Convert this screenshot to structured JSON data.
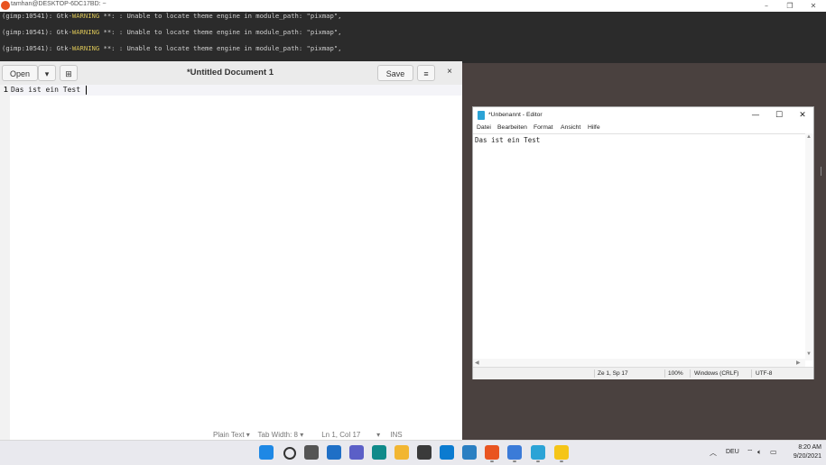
{
  "terminal": {
    "title": "tamhan@DESKTOP-6DC17BD: ~",
    "lines": [
      {
        "prefix": "(gimp:10541): Gtk-",
        "warn": "WARNING",
        "mid": " **: ",
        "mod": "",
        "rest": ": Unable to locate theme engine in module_path: \"pixmap\","
      },
      {
        "prefix": "(gimp:10541): Gtk-",
        "warn": "WARNING",
        "mid": " **: ",
        "mod": "",
        "rest": ": Unable to locate theme engine in module_path: \"pixmap\","
      },
      {
        "prefix": "(gimp:10541): Gtk-",
        "warn": "WARNING",
        "mid": " **: ",
        "mod": "",
        "rest": ": Unable to locate theme engine in module_path: \"pixmap\","
      }
    ],
    "controls": {
      "minimize": "–",
      "maximize": "❐",
      "close": "✕"
    }
  },
  "gedit": {
    "open_label": "Open",
    "dropdown": "▾",
    "new_tab": "⊞",
    "title": "*Untitled Document 1",
    "save_label": "Save",
    "menu": "≡",
    "close": "×",
    "line_number": "1",
    "text": "Das ist ein Test",
    "status": "Plain Text ▾    Tab Width: 8 ▾         Ln 1, Col 17        ▾     INS"
  },
  "notepad": {
    "title": "*Unbenannt - Editor",
    "controls": {
      "minimize": "—",
      "maximize": "☐",
      "close": "✕"
    },
    "menu": [
      "Datei",
      "Bearbeiten",
      "Format",
      "Ansicht",
      "Hilfe"
    ],
    "text": "Das ist ein Test",
    "status": {
      "position": "Ze 1, Sp 17",
      "zoom": "100%",
      "eol": "Windows (CRLF)",
      "encoding": "UTF-8"
    },
    "scroll": {
      "up": "▲",
      "down": "▼",
      "left": "◀",
      "right": "▶"
    }
  },
  "taskbar": {
    "tray": {
      "chevron": "︿",
      "lang": "DEU",
      "wifi": "⌔",
      "volume": "🔈︎",
      "battery": "▭",
      "time": "8:20 AM",
      "date": "9/20/2021"
    },
    "apps": [
      {
        "name": "start-icon",
        "color": "#1e88e5"
      },
      {
        "name": "search-icon",
        "color": "#e9e9ee"
      },
      {
        "name": "task-view-icon",
        "color": "#555555"
      },
      {
        "name": "widgets-icon",
        "color": "#1f6fc6"
      },
      {
        "name": "teams-icon",
        "color": "#5b5fc7"
      },
      {
        "name": "edge-icon",
        "color": "#0f8a8a"
      },
      {
        "name": "file-explorer-icon",
        "color": "#f2b632"
      },
      {
        "name": "store-icon",
        "color": "#3a3a3a"
      },
      {
        "name": "skype-icon",
        "color": "#0b7bd0"
      },
      {
        "name": "photos-icon",
        "color": "#2a7fc2"
      },
      {
        "name": "ubuntu-icon",
        "color": "#e95420"
      },
      {
        "name": "gedit-icon",
        "color": "#3b7bd8"
      },
      {
        "name": "notepad-icon",
        "color": "#2ba3d6"
      },
      {
        "name": "linux-icon",
        "color": "#f5c518"
      }
    ]
  }
}
